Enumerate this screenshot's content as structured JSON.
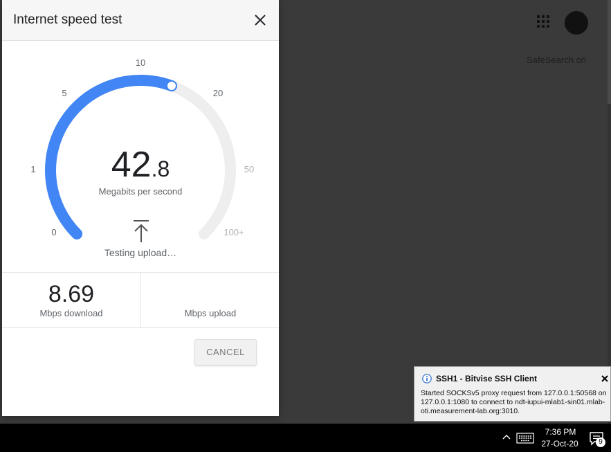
{
  "background": {
    "safesearch_label": "SafeSearch on"
  },
  "dialog": {
    "title": "Internet speed test",
    "gauge": {
      "ticks": [
        "0",
        "1",
        "5",
        "10",
        "20",
        "50",
        "100+"
      ],
      "progress_fraction": 0.575,
      "accent_color": "#4285f4",
      "track_color": "#eeeeee"
    },
    "speed": {
      "integer": "42",
      "decimal": ".8",
      "unit": "Megabits per second"
    },
    "status": "Testing upload…",
    "download": {
      "value": "8.69",
      "label": "Mbps download"
    },
    "upload": {
      "value": "",
      "label": "Mbps upload"
    },
    "cancel_label": "CANCEL"
  },
  "toast": {
    "title": "SSH1 - Bitvise SSH Client",
    "message": "Started SOCKSv5 proxy request from 127.0.0.1:50568 on 127.0.0.1:1080 to connect to ndt-iupui-mlab1-sin01.mlab-oti.measurement-lab.org:3010."
  },
  "taskbar": {
    "time": "7:36 PM",
    "date": "27-Oct-20",
    "notification_count": "9"
  }
}
